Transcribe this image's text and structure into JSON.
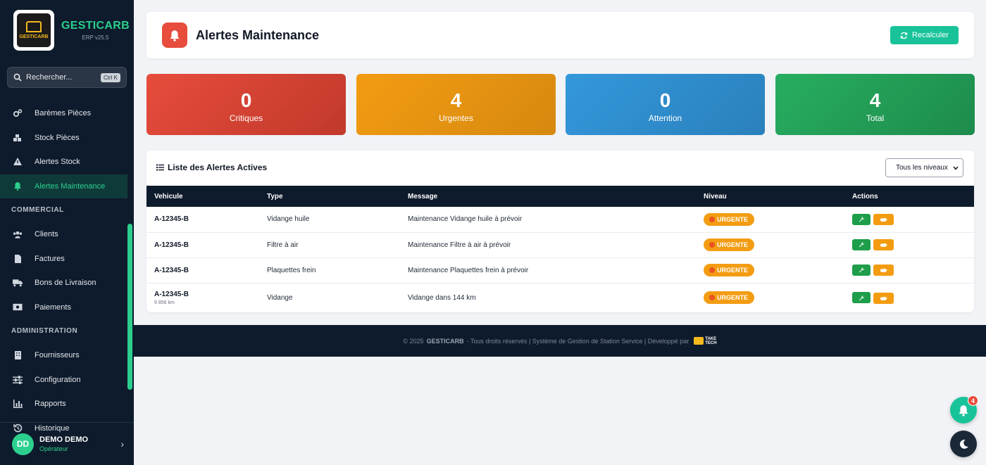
{
  "brand": {
    "name": "GESTICARB",
    "version": "ERP v25.5",
    "logo_text": "GESTICARB"
  },
  "search": {
    "placeholder": "Rechercher...",
    "shortcut": "Ctrl K"
  },
  "sidebar": {
    "items_top": [
      {
        "label": "Barèmes Pièces",
        "icon": "cogs-icon"
      },
      {
        "label": "Stock Pièces",
        "icon": "boxes-icon"
      },
      {
        "label": "Alertes Stock",
        "icon": "warning-icon"
      },
      {
        "label": "Alertes Maintenance",
        "icon": "bell-icon",
        "active": true
      }
    ],
    "section_commercial": "COMMERCIAL",
    "items_commercial": [
      {
        "label": "Clients",
        "icon": "users-icon"
      },
      {
        "label": "Factures",
        "icon": "invoice-icon"
      },
      {
        "label": "Bons de Livraison",
        "icon": "truck-icon"
      },
      {
        "label": "Paiements",
        "icon": "money-icon"
      }
    ],
    "section_admin": "ADMINISTRATION",
    "items_admin": [
      {
        "label": "Fournisseurs",
        "icon": "building-icon"
      },
      {
        "label": "Configuration",
        "icon": "sliders-icon"
      },
      {
        "label": "Rapports",
        "icon": "chart-icon"
      },
      {
        "label": "Historique",
        "icon": "history-icon"
      }
    ]
  },
  "user": {
    "initials": "DD",
    "name": "DEMO DEMO",
    "role": "Opérateur"
  },
  "header": {
    "title": "Alertes Maintenance",
    "recalc_label": "Recalculer"
  },
  "stats": [
    {
      "value": "0",
      "label": "Critiques",
      "color": "#e74c3c"
    },
    {
      "value": "4",
      "label": "Urgentes",
      "color": "#f39c12"
    },
    {
      "value": "0",
      "label": "Attention",
      "color": "#3498db"
    },
    {
      "value": "4",
      "label": "Total",
      "color": "#27ae60"
    }
  ],
  "alerts": {
    "title": "Liste des Alertes Actives",
    "filter": "Tous les niveaux",
    "columns": [
      "Vehicule",
      "Type",
      "Message",
      "Niveau",
      "Actions"
    ],
    "rows": [
      {
        "vehicle": "A-12345-B",
        "sub": "",
        "type": "Vidange huile",
        "message": "Maintenance Vidange huile à prévoir",
        "level": "URGENTE"
      },
      {
        "vehicle": "A-12345-B",
        "sub": "",
        "type": "Filtre à air",
        "message": "Maintenance Filtre à air à prévoir",
        "level": "URGENTE"
      },
      {
        "vehicle": "A-12345-B",
        "sub": "",
        "type": "Plaquettes frein",
        "message": "Maintenance Plaquettes frein à prévoir",
        "level": "URGENTE"
      },
      {
        "vehicle": "A-12345-B",
        "sub": "9 856 km",
        "type": "Vidange",
        "message": "Vidange dans 144 km",
        "level": "URGENTE"
      }
    ]
  },
  "footer": {
    "prefix": "© 2025",
    "brand": "GESTICARB",
    "text": "- Tous droits réservés | Système de Gestion de Station Service | Développé par",
    "dev_line1": "TAKE",
    "dev_line2": "TECH"
  },
  "notifications": {
    "count": "4"
  }
}
